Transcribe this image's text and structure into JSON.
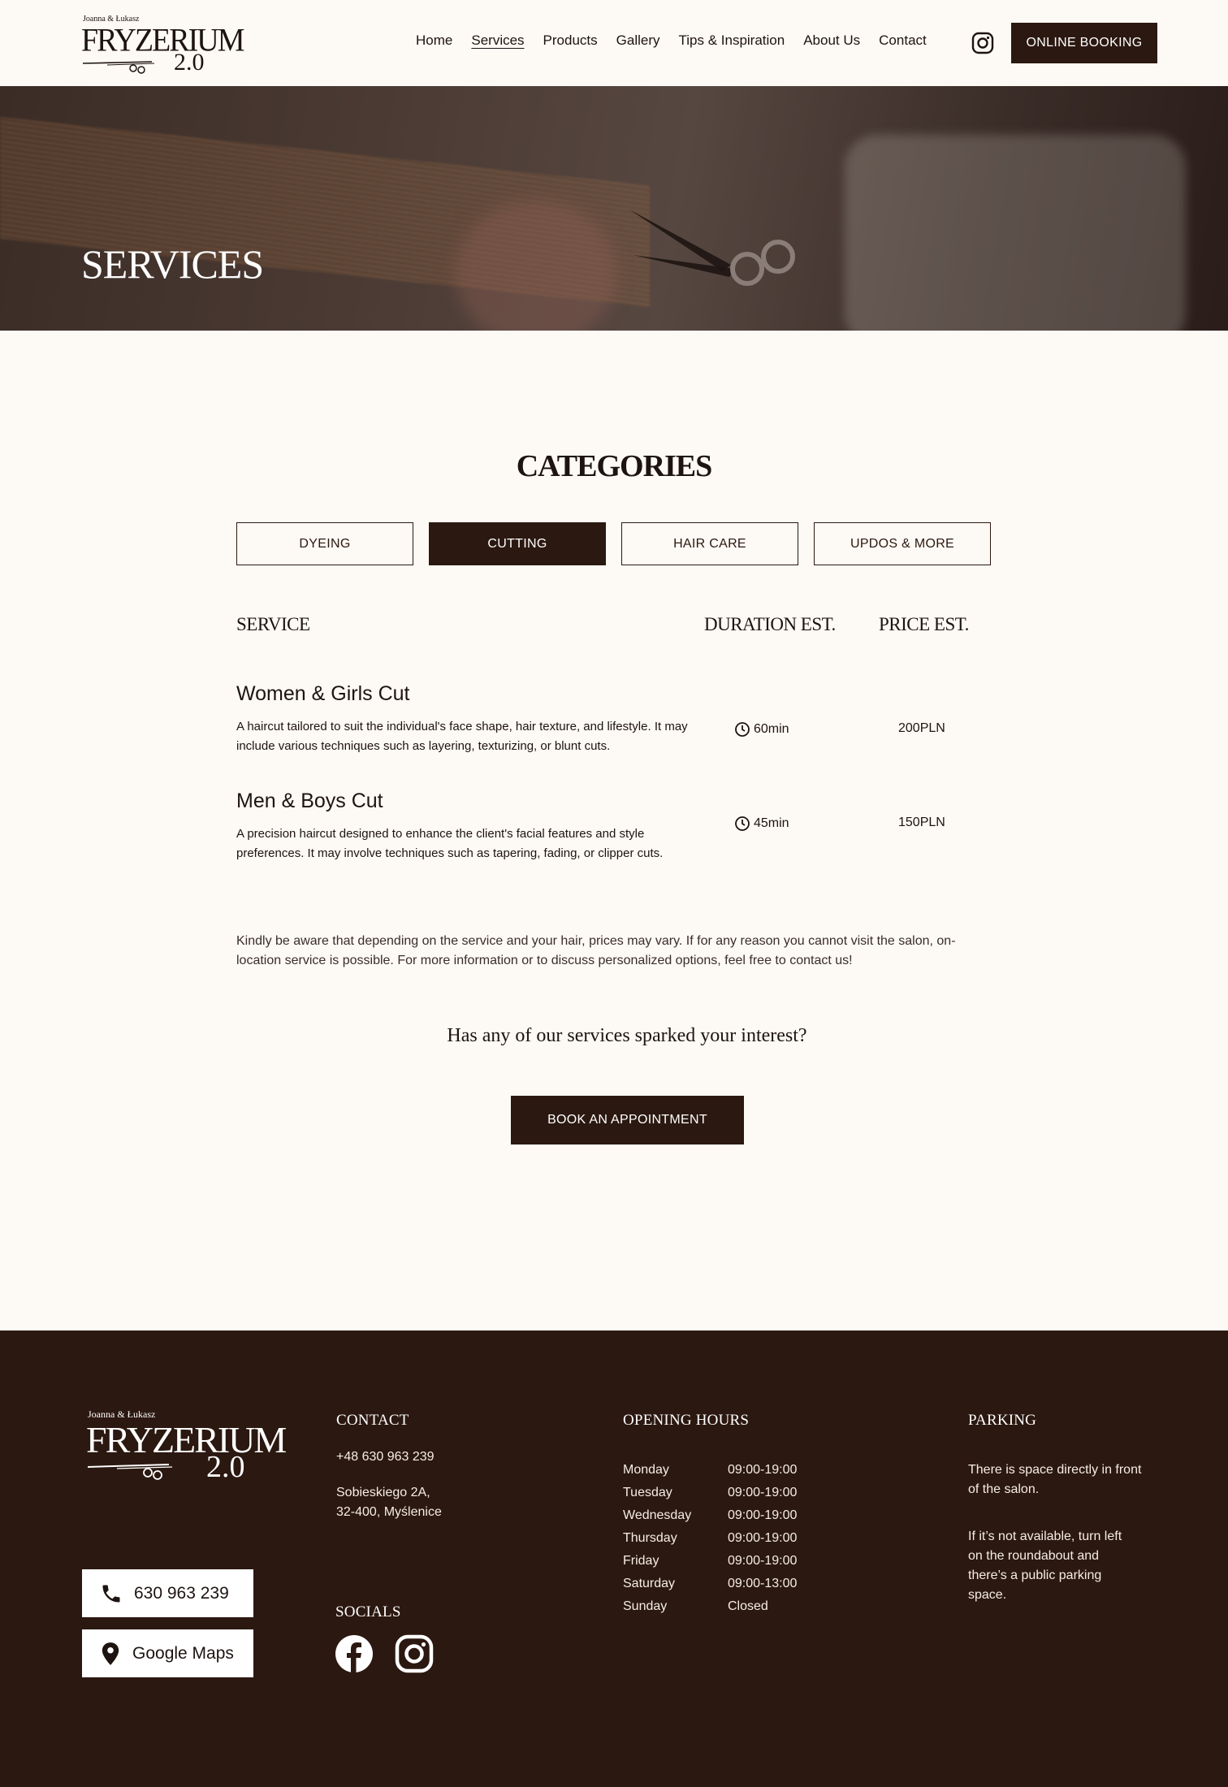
{
  "brand": {
    "owners": "Joanna & Łukasz",
    "name": "FRYZERIUM",
    "version": "2.0"
  },
  "nav": {
    "items": [
      "Home",
      "Services",
      "Products",
      "Gallery",
      "Tips & Inspiration",
      "About Us",
      "Contact"
    ],
    "active": "Services",
    "booking_label": "ONLINE BOOKING"
  },
  "hero": {
    "title": "SERVICES"
  },
  "categories": {
    "title": "CATEGORIES",
    "tabs": [
      "DYEING",
      "CUTTING",
      "HAIR CARE",
      "UPDOS & MORE"
    ],
    "active": "CUTTING"
  },
  "table": {
    "col_service": "SERVICE",
    "col_duration": "DURATION EST.",
    "col_price": "PRICE EST.",
    "rows": [
      {
        "name": "Women & Girls Cut",
        "description": "A haircut tailored to suit the individual's face shape, hair texture, and lifestyle. It may include various techniques such as layering, texturizing, or blunt cuts.",
        "duration": "60min",
        "price": "200PLN"
      },
      {
        "name": "Men & Boys Cut",
        "description": "A precision haircut designed to enhance the client's facial features and style preferences. It may involve techniques such as tapering, fading, or clipper cuts.",
        "duration": "45min",
        "price": "150PLN"
      }
    ]
  },
  "notice": "Kindly be aware that depending on the service and your hair, prices may vary. If for any reason you cannot visit the salon, on-location service is possible.  For more information or to discuss personalized options, feel free to contact us!",
  "cta": {
    "question": "Has any of our services sparked your interest?",
    "button": "BOOK AN APPOINTMENT"
  },
  "footer": {
    "contact_heading": "CONTACT",
    "phone": "+48 630 963 239",
    "address_line1": "Sobieskiego 2A,",
    "address_line2": "32-400, Myślenice",
    "socials_heading": "SOCIALS",
    "hours_heading": "OPENING HOURS",
    "hours": [
      {
        "day": "Monday",
        "time": "09:00-19:00"
      },
      {
        "day": "Tuesday",
        "time": "09:00-19:00"
      },
      {
        "day": "Wednesday",
        "time": "09:00-19:00"
      },
      {
        "day": "Thursday",
        "time": "09:00-19:00"
      },
      {
        "day": "Friday",
        "time": "09:00-19:00"
      },
      {
        "day": "Saturday",
        "time": "09:00-13:00"
      },
      {
        "day": "Sunday",
        "time": "Closed"
      }
    ],
    "parking_heading": "PARKING",
    "parking_text1": "There is space directly in front of the salon.",
    "parking_text2": "If it’s not available, turn left on the roundabout and there’s a public parking space.",
    "phone_button": "630 963 239",
    "maps_button": "Google Maps"
  },
  "colors": {
    "brand_dark": "#2b1810",
    "background": "#fdf9f4"
  },
  "icons": [
    "instagram-icon",
    "clock-icon",
    "phone-icon",
    "map-pin-icon",
    "facebook-icon",
    "scissors-icon"
  ]
}
